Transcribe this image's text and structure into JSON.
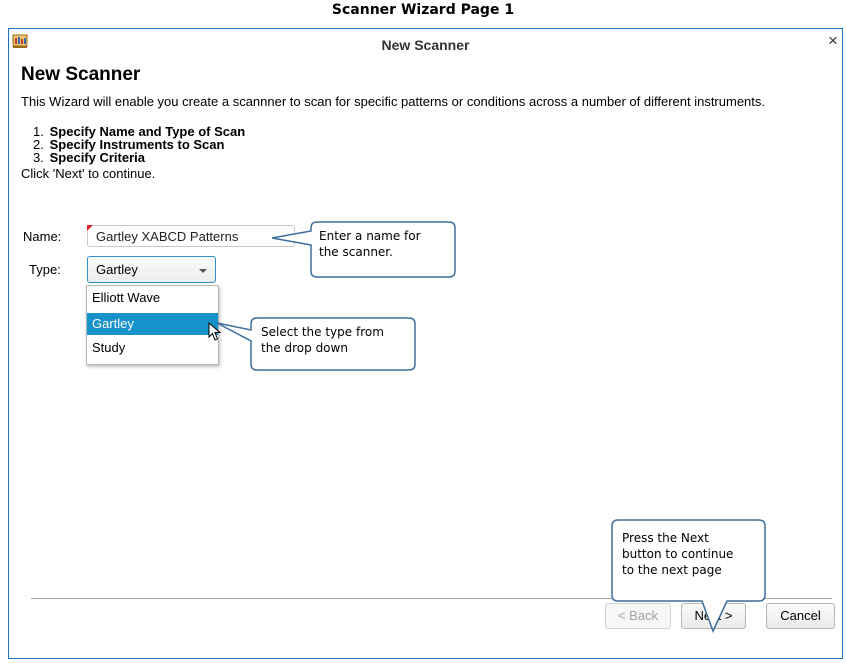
{
  "caption": "Scanner Wizard Page 1",
  "window": {
    "title": "New Scanner",
    "close_glyph": "×",
    "icon": "scanner-app-icon"
  },
  "heading": "New Scanner",
  "intro": "This Wizard will enable you create a scannner to scan for specific patterns or conditions across a number of different instruments.",
  "steps": [
    {
      "num": "1.",
      "text": "Specify Name and Type of Scan"
    },
    {
      "num": "2.",
      "text": "Specify Instruments to Scan"
    },
    {
      "num": "3.",
      "text": "Specify Criteria"
    }
  ],
  "continue_hint": "Click 'Next' to continue.",
  "form": {
    "name_label": "Name:",
    "name_value": "Gartley XABCD Patterns",
    "type_label": "Type:",
    "type_value": "Gartley",
    "type_options": [
      "Elliott Wave",
      "Gartley",
      "Study"
    ],
    "selected_option": "Gartley"
  },
  "callouts": {
    "name": [
      "Enter a name for",
      "the scanner."
    ],
    "type": [
      "Select the type from",
      "the drop down"
    ],
    "next": [
      "Press the Next",
      "button to continue",
      "to the next page"
    ]
  },
  "buttons": {
    "back": "< Back",
    "next": "Next >",
    "cancel": "Cancel"
  },
  "colors": {
    "accent": "#1592c9",
    "window_border": "#1a74c4",
    "callout_border": "#3d6e9e"
  }
}
